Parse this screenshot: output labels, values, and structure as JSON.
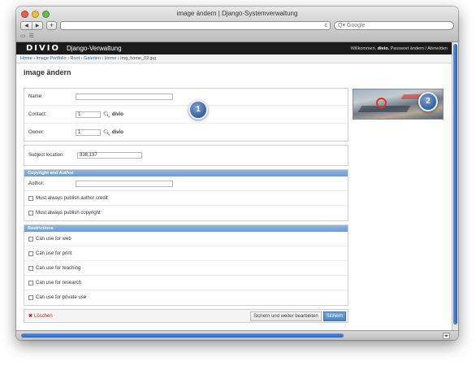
{
  "browser": {
    "title": "image ändern | Django-Systemverwaltung",
    "back_label": "◀",
    "forward_label": "▶",
    "add_tab_label": "+",
    "reload_label": "c",
    "search_placeholder": "Google",
    "bookmark_icons": [
      "reading-list-icon",
      "grid-icon"
    ]
  },
  "header": {
    "logo": "DIVIO",
    "title": "Django-Verwaltung",
    "welcome": "Willkommen,",
    "user": "divio.",
    "change_password": "Passwort ändern",
    "separator": "/",
    "logout": "Abmelden"
  },
  "breadcrumb": [
    {
      "label": "Home"
    },
    {
      "label": "Image Portfolio"
    },
    {
      "label": "Root"
    },
    {
      "label": "Galerien"
    },
    {
      "label": "Home"
    },
    {
      "label": "img_home_02.jpg"
    }
  ],
  "breadcrumb_separator": "›",
  "page_title": "image ändern",
  "fields": {
    "name_label": "Name:",
    "name_value": "",
    "contact_label": "Contact:",
    "contact_value": "1",
    "contact_user": "divio",
    "owner_label": "Owner:",
    "owner_value": "1",
    "owner_user": "divio",
    "subject_label": "Subject location:",
    "subject_value": "338,137"
  },
  "copyright": {
    "heading": "Copyright and Author",
    "author_label": "Author:",
    "author_value": "",
    "credit_label": "Must always publish author credit",
    "copyright_label": "Must always publish copyright"
  },
  "restrictions": {
    "heading": "Restrictions",
    "items": [
      "Can use for web",
      "Can use for print",
      "Can use for teaching",
      "Can use for research",
      "Can use for private use"
    ]
  },
  "actions": {
    "delete_label": "Löschen",
    "save_continue_label": "Sichern und weiter bearbeiten",
    "save_label": "Sichern"
  },
  "badges": [
    "1",
    "2"
  ],
  "colors": {
    "header_bg": "#1b1b1b",
    "module_header": "#7ba5d9",
    "link": "#3a6ea5",
    "delete": "#cc2222",
    "primary_button": "#5a8fcf"
  }
}
